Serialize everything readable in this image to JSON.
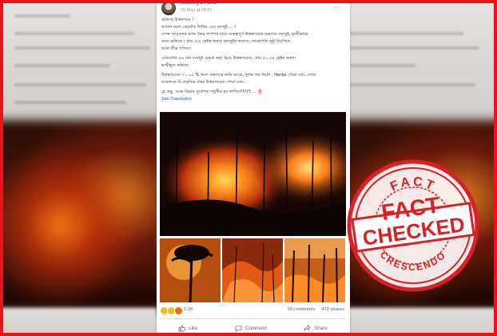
{
  "post": {
    "author": "Axomiya Yuva",
    "date": "26 May at 08:22 ·",
    "menu_glyph": "···",
    "lines": [
      "জ্বলিছে উত্তৰাখণ্ড !",
      "আমাৰ মনো কেনেকৈ লিখিম এয়া বনজুই ... !",
      "দেশৰ আয়তনৰ আৰু জৈৱ সম্পদৰ বাবে গুৰুত্বপূৰ্ণ উত্তৰাখণ্ডৰ অৰণ্যত বনজুই, ভাৰীভাৱে",
      "সময় জ্বলিছে । প্ৰায় ৫-৬ হেক্টৰ অৰণ্য বনজুইৰ কবলত, তাৰোপৰি জুই বিয়পিছে",
      "আৰু তীব্ৰ গতিত।",
      "এতিয়ালৈ ৪৬ বাৰ বনজুই ৰেকৰ্ড কৰা হৈছে উত্তৰাখণ্ডত, প্ৰায় ৫১.৩৪ হেক্টৰ অৰণ্য",
      "ভস্মীভূত কৰিছে।",
      "উত্তৰাখণ্ডত ৭১.০৫ % অংশ অৰণ্যৰে ঢাকি আছে, দুৰ্লভ গছ গছনি , Herbs পোৱা যায়, দেশৰ",
      "আচলতে যি প্ৰকৃতিৰ ঐশ্বৰ্য উত্তৰাখণ্ডত পোৱা যায়।",
      "হে প্ৰভু, আৰু কিমান দুৰ্যোগৰ সন্মুখীন হব লাগিব????? ...",
      "‼️"
    ],
    "see_translation": "See Translation"
  },
  "engagement": {
    "reaction_count": "1.2K",
    "comments": "50 comments",
    "shares": "470 shares",
    "reaction_icons": [
      "haha-icon",
      "sad-icon",
      "angry-icon"
    ]
  },
  "actions": {
    "like": "Like",
    "comment": "Comment",
    "share": "Share"
  },
  "stamp": {
    "top": "FACT",
    "line1": "FACT",
    "line2": "CHECKED",
    "bottom": "CRESCENDO"
  },
  "colors": {
    "frame": "#e8141a",
    "stamp": "#d72126",
    "link": "#385898"
  }
}
